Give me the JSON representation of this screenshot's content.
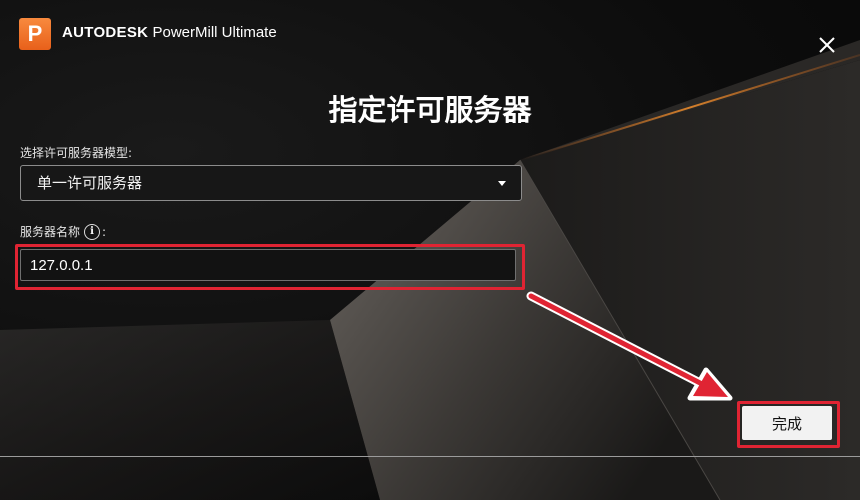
{
  "window": {
    "logo_letter": "P",
    "brand": "AUTODESK",
    "product": "PowerMill Ultimate",
    "close_glyph": "close-icon"
  },
  "dialog": {
    "title": "指定许可服务器",
    "model_label": "选择许可服务器模型:",
    "model_selected": "单一许可服务器",
    "name_label": "服务器名称",
    "name_label_suffix": ":",
    "info_glyph": "i",
    "server_name_value": "127.0.0.1",
    "finish_label": "完成"
  },
  "icons": {
    "logo": "powermill-logo-icon",
    "close": "close-icon",
    "dropdown": "chevron-down-icon",
    "info": "info-icon"
  },
  "colors": {
    "accent_logo": "#e8601a",
    "highlight_red": "#e02433",
    "background": "#0c0c0c",
    "button_bg": "#f2f2f2"
  }
}
